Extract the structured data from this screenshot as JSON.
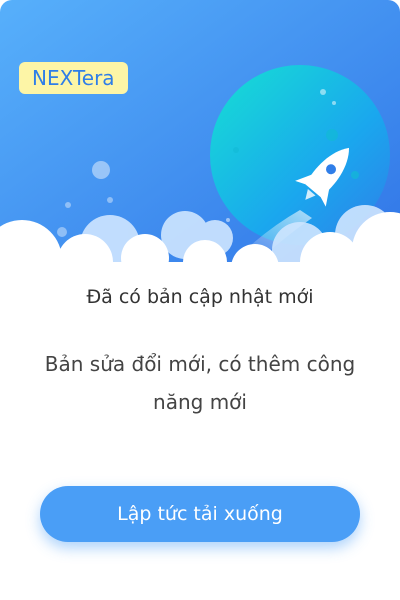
{
  "brand": {
    "name": "NEXTera"
  },
  "hero": {
    "illustration": "rocket-launch-icon"
  },
  "dialog": {
    "title": "Đã có bản cập nhật mới",
    "description": "Bản sửa đổi mới, có thêm công năng mới"
  },
  "actions": {
    "download_label": "Lập tức tải xuống"
  },
  "colors": {
    "primary": "#4a9ef6",
    "badge_bg": "#fdf5a6",
    "badge_text": "#2f7ee8",
    "planet": "#18c3e4"
  }
}
